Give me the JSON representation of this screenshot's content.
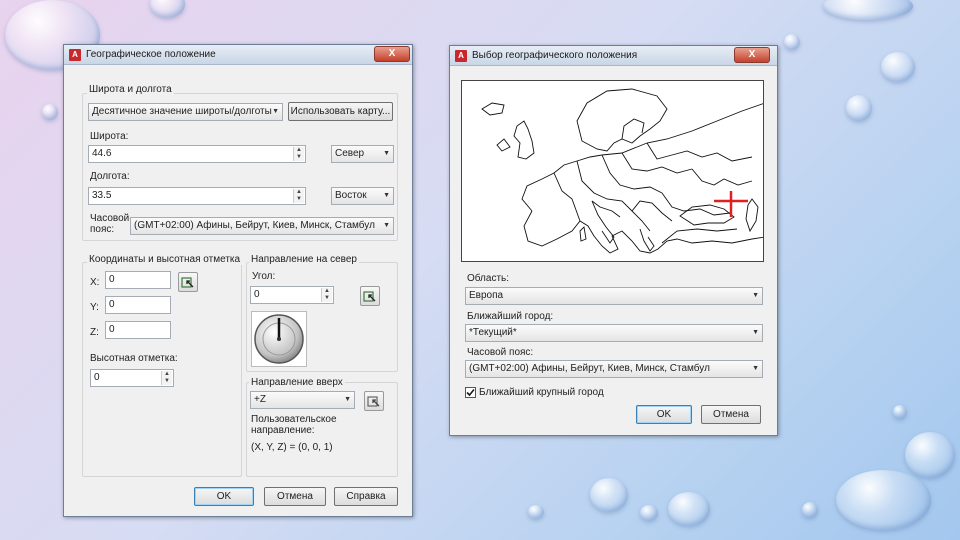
{
  "geo_dialog": {
    "title": "Географическое положение",
    "close_label": "X",
    "latlon_group": {
      "title": "Широта и долгота",
      "format_select": "Десятичное значение широты/долготы",
      "use_map_button": "Использовать карту...",
      "latitude_label": "Широта:",
      "latitude_value": "44.6",
      "latitude_dir": "Север",
      "longitude_label": "Долгота:",
      "longitude_value": "33.5",
      "longitude_dir": "Восток",
      "timezone_label_line1": "Часовой",
      "timezone_label_line2": "пояс:",
      "timezone_value": "(GMT+02:00) Афины, Бейрут, Киев, Минск, Стамбул"
    },
    "coords_group": {
      "title": "Координаты и высотная отметка",
      "x_label": "X:",
      "x_value": "0",
      "y_label": "Y:",
      "y_value": "0",
      "z_label": "Z:",
      "z_value": "0",
      "elevation_label": "Высотная отметка:",
      "elevation_value": "0"
    },
    "north_group": {
      "title": "Направление на север",
      "angle_label": "Угол:",
      "angle_value": "0"
    },
    "up_group": {
      "title": "Направление вверх",
      "up_value": "+Z",
      "custom_label_line1": "Пользовательское",
      "custom_label_line2": "направление:",
      "custom_value": "(X, Y, Z) = (0, 0, 1)"
    },
    "buttons": {
      "ok": "OK",
      "cancel": "Отмена",
      "help": "Справка"
    }
  },
  "map_dialog": {
    "title": "Выбор географического положения",
    "close_label": "X",
    "region_label": "Область:",
    "region_value": "Европа",
    "city_label": "Ближайший город:",
    "city_value": "*Текущий*",
    "timezone_label": "Часовой пояс:",
    "timezone_value": "(GMT+02:00) Афины, Бейрут, Киев, Минск, Стамбул",
    "nearest_checkbox_label": "Ближайший крупный город",
    "nearest_checked": true,
    "buttons": {
      "ok": "OK",
      "cancel": "Отмена"
    }
  },
  "colors": {
    "marker": "#e02020",
    "accent": "#3c7fb1",
    "close": "#c4402c"
  },
  "icons": [
    "app-icon",
    "close-icon",
    "pick-point-icon",
    "dropdown-arrow-icon",
    "compass-icon",
    "location-marker-icon",
    "checkbox-icon"
  ]
}
